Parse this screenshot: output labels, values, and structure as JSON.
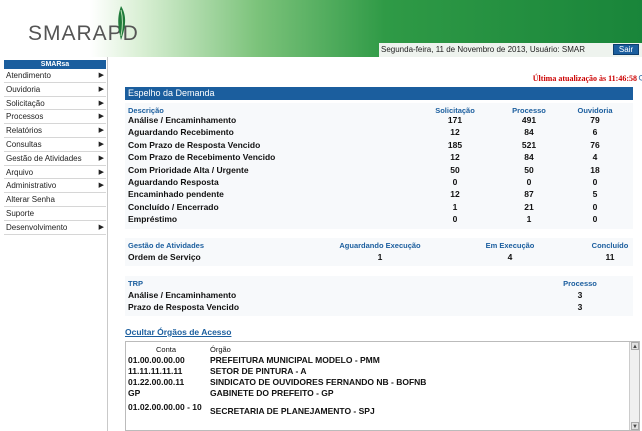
{
  "header": {
    "logo": "SMARAPD",
    "status": "Segunda-feira, 11 de Novembro de 2013, Usuário: SMAR",
    "logout": "Sair"
  },
  "sidebar": {
    "title": "SMARsa",
    "items": [
      {
        "label": "Atendimento",
        "arrow": true
      },
      {
        "label": "Ouvidoria",
        "arrow": true
      },
      {
        "label": "Solicitação",
        "arrow": true
      },
      {
        "label": "Processos",
        "arrow": true
      },
      {
        "label": "Relatórios",
        "arrow": true
      },
      {
        "label": "Consultas",
        "arrow": true
      },
      {
        "label": "Gestão de Atividades",
        "arrow": true
      },
      {
        "label": "Arquivo",
        "arrow": true
      },
      {
        "label": "Administrativo",
        "arrow": true
      },
      {
        "label": "Alterar Senha",
        "arrow": false
      },
      {
        "label": "Suporte",
        "arrow": false
      },
      {
        "label": "Desenvolvimento",
        "arrow": true
      }
    ]
  },
  "main": {
    "updated": "Última atualização às 11:46:58",
    "title": "Espelho da Demanda"
  },
  "demand": {
    "headers": [
      "Descrição",
      "Solicitação",
      "Processo",
      "Ouvidoria"
    ],
    "rows": [
      [
        "Análise / Encaminhamento",
        "171",
        "491",
        "79"
      ],
      [
        "Aguardando Recebimento",
        "12",
        "84",
        "6"
      ],
      [
        "Com Prazo de Resposta Vencido",
        "185",
        "521",
        "76"
      ],
      [
        "Com Prazo de Recebimento Vencido",
        "12",
        "84",
        "4"
      ],
      [
        "Com Prioridade Alta / Urgente",
        "50",
        "50",
        "18"
      ],
      [
        "Aguardando Resposta",
        "0",
        "0",
        "0"
      ],
      [
        "Encaminhado pendente",
        "12",
        "87",
        "5"
      ],
      [
        "Concluído / Encerrado",
        "1",
        "21",
        "0"
      ],
      [
        "Empréstimo",
        "0",
        "1",
        "0"
      ]
    ]
  },
  "activities": {
    "headers": [
      "Gestão de Atividades",
      "Aguardando Execução",
      "Em Execução",
      "Concluído"
    ],
    "row": [
      "Ordem de Serviço",
      "1",
      "4",
      "11"
    ]
  },
  "trp": {
    "headers": [
      "TRP",
      "Processo"
    ],
    "rows": [
      [
        "Análise / Encaminhamento",
        "3"
      ],
      [
        "Prazo de Resposta Vencido",
        "3"
      ]
    ]
  },
  "organs": {
    "toggle": "Ocultar Órgãos de Acesso",
    "headers": [
      "Conta",
      "Órgão"
    ],
    "rows": [
      [
        "01.00.00.00.00",
        "PREFEITURA MUNICIPAL MODELO - PMM"
      ],
      [
        "11.11.11.11.11",
        "SETOR DE PINTURA - A"
      ],
      [
        "01.22.00.00.11",
        "SINDICATO DE OUVIDORES FERNANDO NB - BOFNB"
      ],
      [
        "GP",
        "GABINETE DO PREFEITO - GP"
      ],
      [
        "01.02.00.00.00 - 10",
        "SECRETARIA DE PLANEJAMENTO - SPJ"
      ]
    ]
  }
}
